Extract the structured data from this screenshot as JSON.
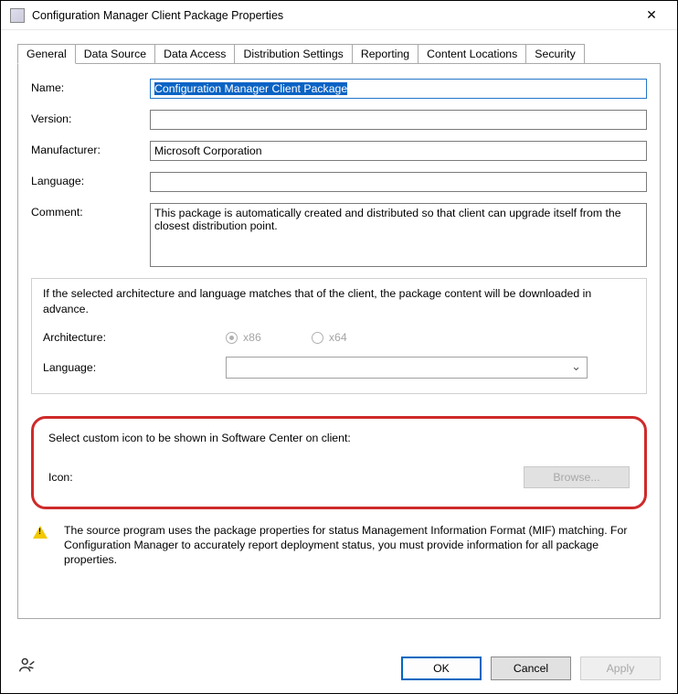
{
  "window": {
    "title": "Configuration Manager Client Package Properties"
  },
  "tabs": [
    "General",
    "Data Source",
    "Data Access",
    "Distribution Settings",
    "Reporting",
    "Content Locations",
    "Security"
  ],
  "activeTab": 0,
  "form": {
    "labels": {
      "name": "Name:",
      "version": "Version:",
      "manufacturer": "Manufacturer:",
      "language": "Language:",
      "comment": "Comment:"
    },
    "values": {
      "name": "Configuration Manager Client Package",
      "version": "",
      "manufacturer": "Microsoft Corporation",
      "language": "",
      "comment": "This package is automatically created and distributed so that client can upgrade itself from the closest distribution point."
    }
  },
  "archGroup": {
    "note": "If the selected architecture and language matches that of the client, the package content will be downloaded in advance.",
    "labels": {
      "architecture": "Architecture:",
      "language": "Language:"
    },
    "radios": {
      "x86": "x86",
      "x64": "x64"
    },
    "x86_selected": true
  },
  "iconSection": {
    "heading": "Select custom icon to be shown in Software Center on client:",
    "label": "Icon:",
    "browse": "Browse..."
  },
  "warning": "The source program uses the package properties for status Management Information Format (MIF) matching. For Configuration Manager to accurately report deployment status, you must provide information for all package properties.",
  "buttons": {
    "ok": "OK",
    "cancel": "Cancel",
    "apply": "Apply"
  }
}
